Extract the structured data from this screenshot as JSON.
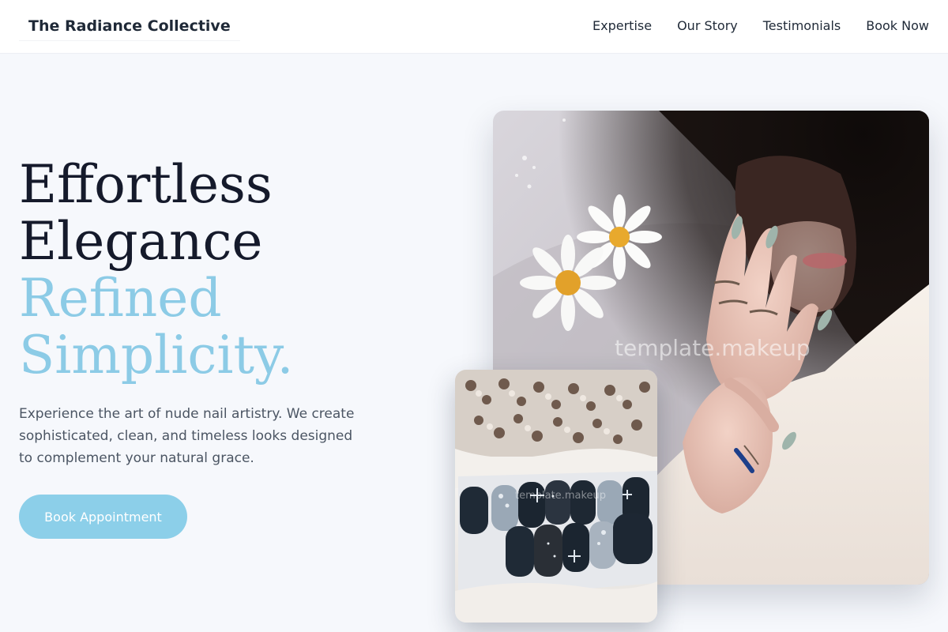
{
  "header": {
    "brand": "The Radiance Collective",
    "nav": [
      "Expertise",
      "Our Story",
      "Testimonials",
      "Book Now"
    ]
  },
  "hero": {
    "title_lines": [
      "Effortless",
      "Elegance",
      "Refined",
      "Simplicity."
    ],
    "description": "Experience the art of nude nail artistry. We create sophisticated, clean, and timeless looks designed to complement your natural grace.",
    "cta_label": "Book Appointment"
  },
  "images": {
    "watermark": "template.makeup"
  },
  "colors": {
    "accent": "#8ccfe9",
    "heading_dark": "#151a2b",
    "heading_light": "#8ccbe6",
    "background": "#f6f8fc"
  }
}
